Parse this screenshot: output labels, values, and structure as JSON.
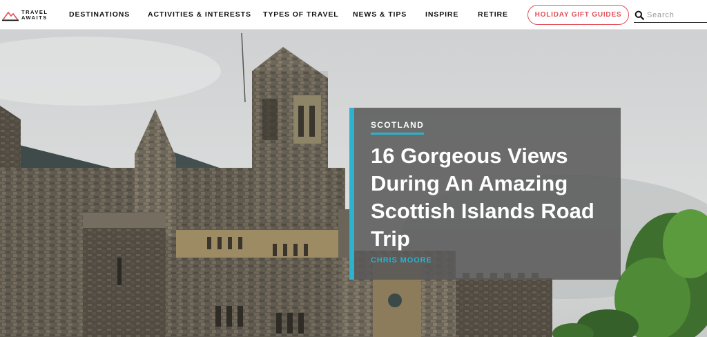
{
  "brand": {
    "line1": "TRAVEL",
    "line2": "AWAITS",
    "accent": "#e2505a"
  },
  "nav": {
    "items": [
      {
        "label": "DESTINATIONS"
      },
      {
        "label": "ACTIVITIES & INTERESTS"
      },
      {
        "label": "TYPES OF TRAVEL"
      },
      {
        "label": "NEWS & TIPS"
      },
      {
        "label": "INSPIRE"
      },
      {
        "label": "RETIRE"
      }
    ],
    "gift_button": "HOLIDAY GIFT GUIDES"
  },
  "search": {
    "placeholder": "Search",
    "icon": "search-icon"
  },
  "hero": {
    "category": "SCOTLAND",
    "title": "16 Gorgeous Views During An Amazing Scottish Islands Road Trip",
    "author": "CHRIS MOORE",
    "accent_color": "#2bb3cf"
  }
}
